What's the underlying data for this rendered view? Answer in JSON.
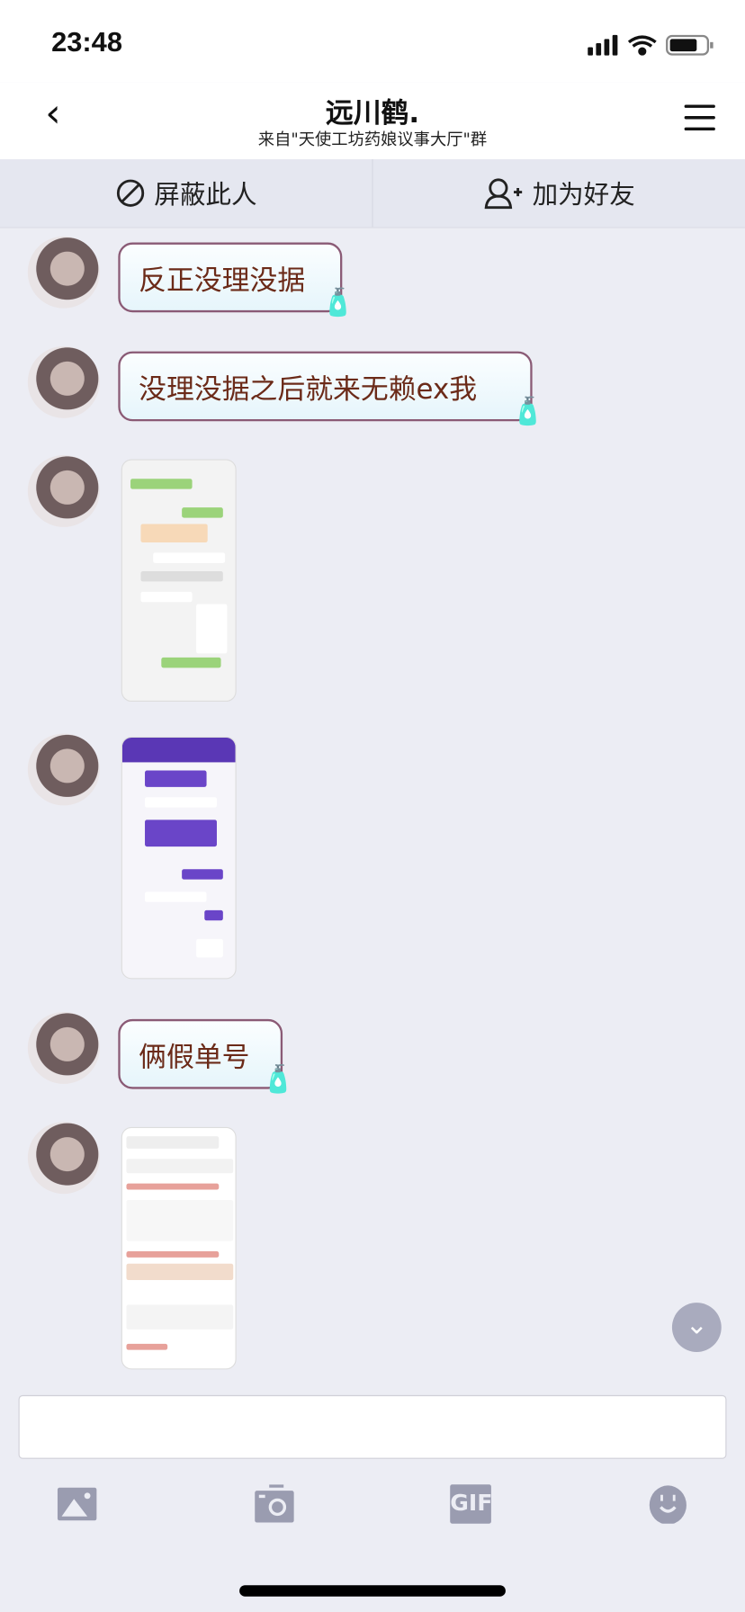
{
  "status_bar": {
    "time": "23:48"
  },
  "header": {
    "title": "远川鹤.",
    "subtitle": "来自\"天使工坊药娘议事大厅\"群"
  },
  "actions": {
    "block": "屏蔽此人",
    "add_friend": "加为好友"
  },
  "messages": [
    {
      "type": "text",
      "text": "反正没理没据"
    },
    {
      "type": "text",
      "text": "没理没据之后就来无赖ex我"
    },
    {
      "type": "image",
      "theme": "green-chat-screenshot"
    },
    {
      "type": "image",
      "theme": "purple-chat-screenshot"
    },
    {
      "type": "text",
      "text": "俩假单号"
    },
    {
      "type": "image",
      "theme": "order-screenshot"
    }
  ],
  "input": {
    "value": "",
    "placeholder": ""
  },
  "toolbar": {
    "icons": [
      "image-icon",
      "camera-icon",
      "gif-icon",
      "emoji-icon"
    ],
    "gif_label": "GIF"
  },
  "colors": {
    "accent": "#a9abbe",
    "bubble_text": "#6b2a18",
    "background": "#ecedf4"
  }
}
